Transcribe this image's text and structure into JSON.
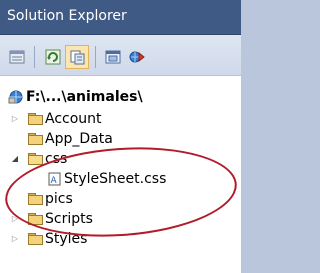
{
  "window": {
    "title": "Solution Explorer"
  },
  "toolbar": {
    "buttons": [
      {
        "icon": "properties-icon"
      },
      {
        "icon": "refresh-icon"
      },
      {
        "icon": "show-all-files-icon"
      },
      {
        "icon": "view-designer-icon"
      },
      {
        "icon": "copy-website-icon"
      }
    ]
  },
  "tree": {
    "root": {
      "label": "F:\\...\\animales\\",
      "icon": "website-globe-icon"
    },
    "items": [
      {
        "label": "Account",
        "type": "folder",
        "expanded": false
      },
      {
        "label": "App_Data",
        "type": "folder",
        "expanded": false
      },
      {
        "label": "css",
        "type": "folder",
        "expanded": true
      },
      {
        "label": "StyleSheet.css",
        "type": "file",
        "icon": "stylesheet-icon"
      },
      {
        "label": "pics",
        "type": "folder",
        "expanded": false
      },
      {
        "label": "Scripts",
        "type": "folder",
        "expanded": false
      },
      {
        "label": "Styles",
        "type": "folder",
        "expanded": false
      }
    ]
  },
  "annotation": {
    "color": "#b11c2a",
    "target": "css"
  },
  "colors": {
    "titlebar": "#3f5a84",
    "toolbar": "#d8e0ee",
    "folder": "#f2d37c"
  }
}
